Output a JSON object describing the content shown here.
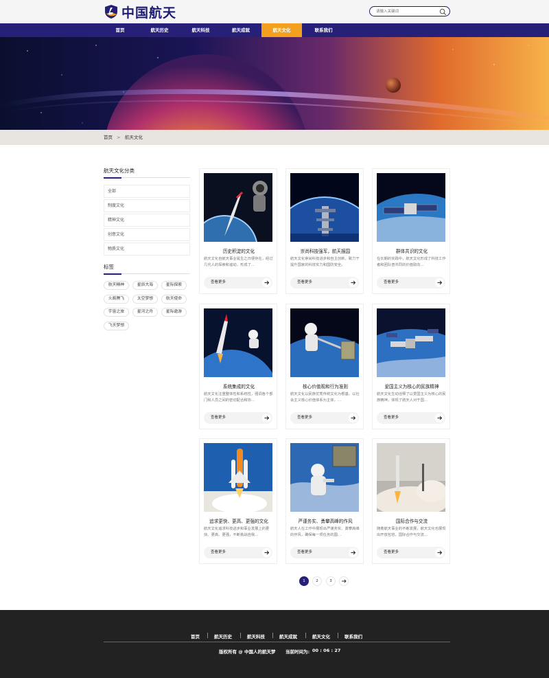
{
  "brand": {
    "name": "中国航天",
    "accent": "#262079",
    "highlight": "#f2a01e"
  },
  "search": {
    "placeholder": "请输入关键词"
  },
  "nav": [
    {
      "label": "首页"
    },
    {
      "label": "航天历史"
    },
    {
      "label": "航天科技"
    },
    {
      "label": "航天成就"
    },
    {
      "label": "航天文化",
      "active": true
    },
    {
      "label": "联系我们"
    }
  ],
  "breadcrumb": {
    "home": "首页",
    "separator": ">",
    "current": "航天文化"
  },
  "sidebar": {
    "category_title": "航天文化分类",
    "categories": [
      "全部",
      "制度文化",
      "精神文化",
      "创意文化",
      "物质文化"
    ],
    "tags_title": "标签",
    "tags": [
      "航天精神",
      "星辰大海",
      "星际探索",
      "火箭腾飞",
      "太空梦想",
      "航天使命",
      "宇宙之旅",
      "星河之舟",
      "星际遨游",
      "飞天梦想"
    ]
  },
  "cards": [
    {
      "title": "历史积淀的文化",
      "desc": "航天文化自航天事业诞生之日便存在，经过几代人的探索和追动，形成了…",
      "button": "查看更多",
      "image": "rocket-astronaut-earth"
    },
    {
      "title": "崇尚科技强军，航天报国",
      "desc": "航天文化崇尚科技进步和自主创新，致力于提升国家的科技实力和国防安全。",
      "button": "查看更多",
      "image": "space-station-earth"
    },
    {
      "title": "群体共识的文化",
      "desc": "在长期的实践中，航天文化形成了科技工作者和团队普共同的价值取向…",
      "button": "查看更多",
      "image": "satellite-orbit"
    },
    {
      "title": "系统集成的文化",
      "desc": "航天文化注重整体性和系统性，强调各个部门和人员之间的密切配合和协…",
      "button": "查看更多",
      "image": "rocket-launch-astronaut"
    },
    {
      "title": "核心价值观和行为准则",
      "desc": "航天文化以民族优秀传统文化为根基，以社会主义核心价值体系为主体，…",
      "button": "查看更多",
      "image": "spacewalk-panel"
    },
    {
      "title": "爱国主义为核心的民族精神",
      "desc": "航天文化生动诠释了以爱国主义为核心的民族精神，体现了航天人对于国…",
      "button": "查看更多",
      "image": "station-over-earth"
    },
    {
      "title": "追求更快、更高、更强的文化",
      "desc": "航天文化追求科技进步和事业发展上的更快、更高、更强，不断挑战自我…",
      "button": "查看更多",
      "image": "shuttle-liftoff"
    },
    {
      "title": "严谨务实、勇攀高峰的作风",
      "desc": "航天人在工作中展现出严谨务实、勇攀高峰的作风，确保每一项任务的圆…",
      "button": "查看更多",
      "image": "astronaut-spacewalk"
    },
    {
      "title": "国际合作与交流",
      "desc": "随着航天事业的不断发展，航天文化也展现出开放包容、国际合作与交流…",
      "button": "查看更多",
      "image": "rocket-launch-pad"
    }
  ],
  "pagination": {
    "pages": [
      "1",
      "2",
      "3"
    ],
    "current": "1",
    "next_icon": "arrow-right-icon"
  },
  "footer": {
    "links": [
      "首页",
      "航天历史",
      "航天科技",
      "航天成就",
      "航天文化",
      "联系我们"
    ],
    "copyright": "版权所有 @ 中国人的航天梦",
    "time_label": "当前时间为:",
    "time_value": "00 : 06 : 27"
  }
}
